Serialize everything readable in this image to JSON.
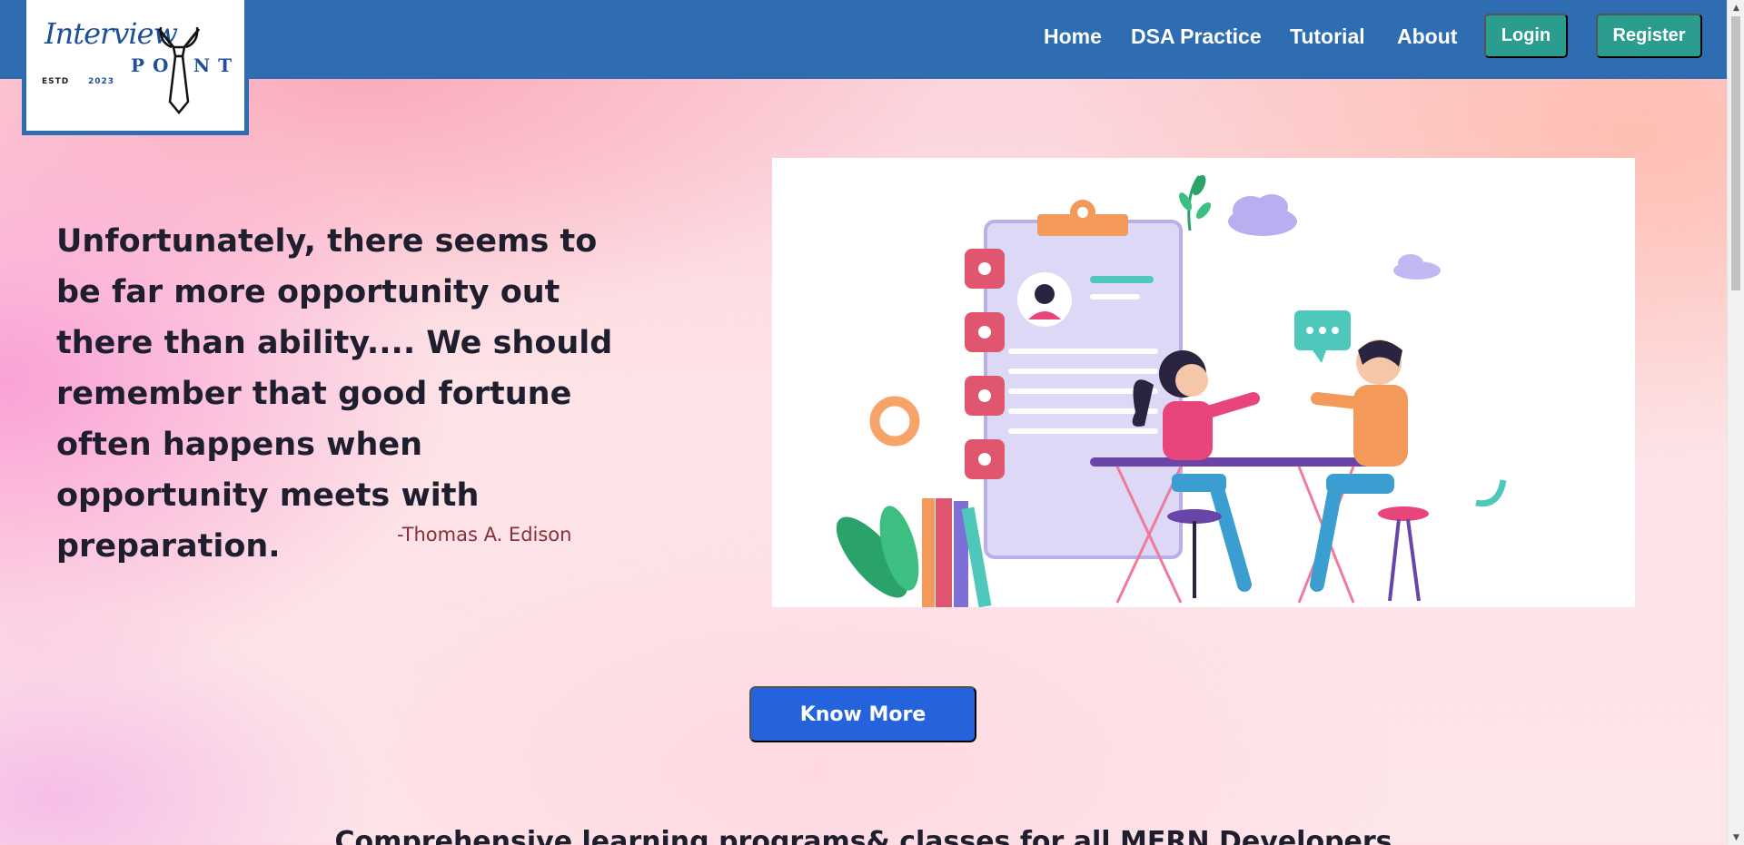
{
  "navbar": {
    "logo": {
      "script_text": "Interview",
      "point_text": "POINT",
      "estd": "ESTD",
      "year": "2023"
    },
    "links": [
      "Home",
      "DSA Practice",
      "Tutorial",
      "About"
    ],
    "login_label": "Login",
    "register_label": "Register"
  },
  "hero": {
    "quote": "Unfortunately, there seems to be far more opportunity out there than ability.... We should remember that good fortune often happens when opportunity meets with preparation.",
    "author": "-Thomas A. Edison",
    "cta_label": "Know More"
  },
  "section": {
    "heading": "Comprehensive learning programs& classes for all MERN Developers"
  },
  "colors": {
    "navbar": "#2e6db2",
    "nav_button": "#2a9d8f",
    "cta_button": "#2463dc",
    "author_text": "#8a2f3a"
  }
}
